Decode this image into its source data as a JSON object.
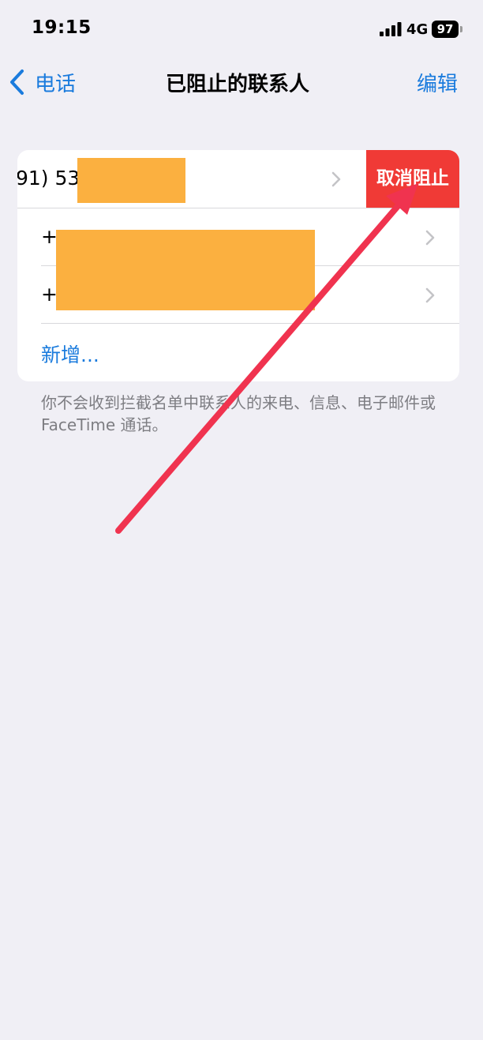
{
  "status_bar": {
    "time": "19:15",
    "network": "4G",
    "battery": "97",
    "icons": [
      "signal-icon",
      "battery-icon"
    ]
  },
  "nav": {
    "back_label": "电话",
    "title": "已阻止的联系人",
    "edit_label": "编辑",
    "icons": [
      "chevron-left-icon"
    ]
  },
  "blocked_list": {
    "rows": [
      {
        "number_visible": "91) 53",
        "redacted": true,
        "swiped": true
      },
      {
        "number_visible": "+",
        "redacted": true,
        "swiped": false
      },
      {
        "number_visible": "+",
        "redacted": true,
        "swiped": false
      }
    ],
    "unblock_label": "取消阻止",
    "add_new_label": "新增..."
  },
  "footer_note": "你不会收到拦截名单中联系人的来电、信息、电子邮件或 FaceTime 通话。",
  "colors": {
    "background": "#F0EFF5",
    "accent_blue": "#1A7BDD",
    "unblock_red": "#F03A36",
    "redaction": "#FBB040",
    "annotation_arrow": "#F0334F"
  }
}
